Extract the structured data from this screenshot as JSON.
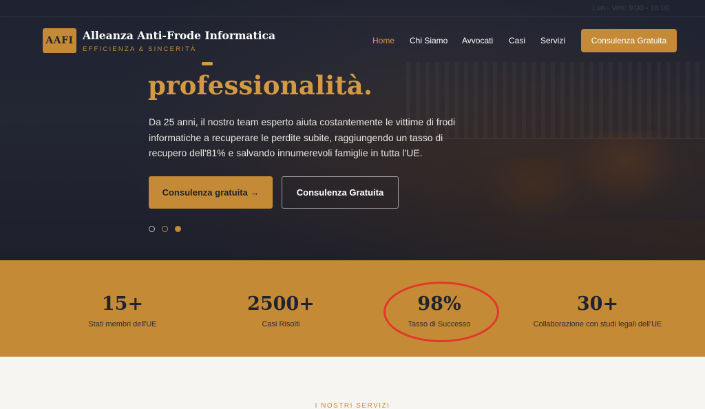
{
  "topbar": {
    "hours": "Lun - Ven: 9:00 - 18:00"
  },
  "brand": {
    "logo_text": "AAFI",
    "name": "Alleanza Anti-Frode Informatica",
    "tagline": "EFFICIENZA & SINCERITÀ"
  },
  "nav": {
    "items": [
      {
        "label": "Home",
        "active": true
      },
      {
        "label": "Chi Siamo",
        "active": false
      },
      {
        "label": "Avvocati",
        "active": false
      },
      {
        "label": "Casi",
        "active": false
      },
      {
        "label": "Servizi",
        "active": false
      }
    ],
    "cta": "Consulenza Gratuita"
  },
  "hero": {
    "headline": "professionalità.",
    "body": "Da 25 anni, il nostro team esperto aiuta costantemente le vittime di frodi informatiche a recuperare le perdite subite, raggiungendo un tasso di recupero dell'81% e salvando innumerevoli famiglie in tutta l'UE.",
    "primary_button": "Consulenza gratuita →",
    "secondary_button": "Consulenza Gratuita",
    "slides": {
      "count": 3,
      "active_index": 2
    }
  },
  "stats": [
    {
      "value": "15+",
      "label": "Stati membri dell'UE"
    },
    {
      "value": "2500+",
      "label": "Casi Risolti"
    },
    {
      "value": "98%",
      "label": "Tasso di Successo"
    },
    {
      "value": "30+",
      "label": "Collaborazione con studi legali dell'UE"
    }
  ],
  "services": {
    "section_label": "I NOSTRI SERVIZI"
  },
  "colors": {
    "accent": "#c58a35",
    "dark": "#1f2230",
    "highlight": "#e2372a"
  }
}
